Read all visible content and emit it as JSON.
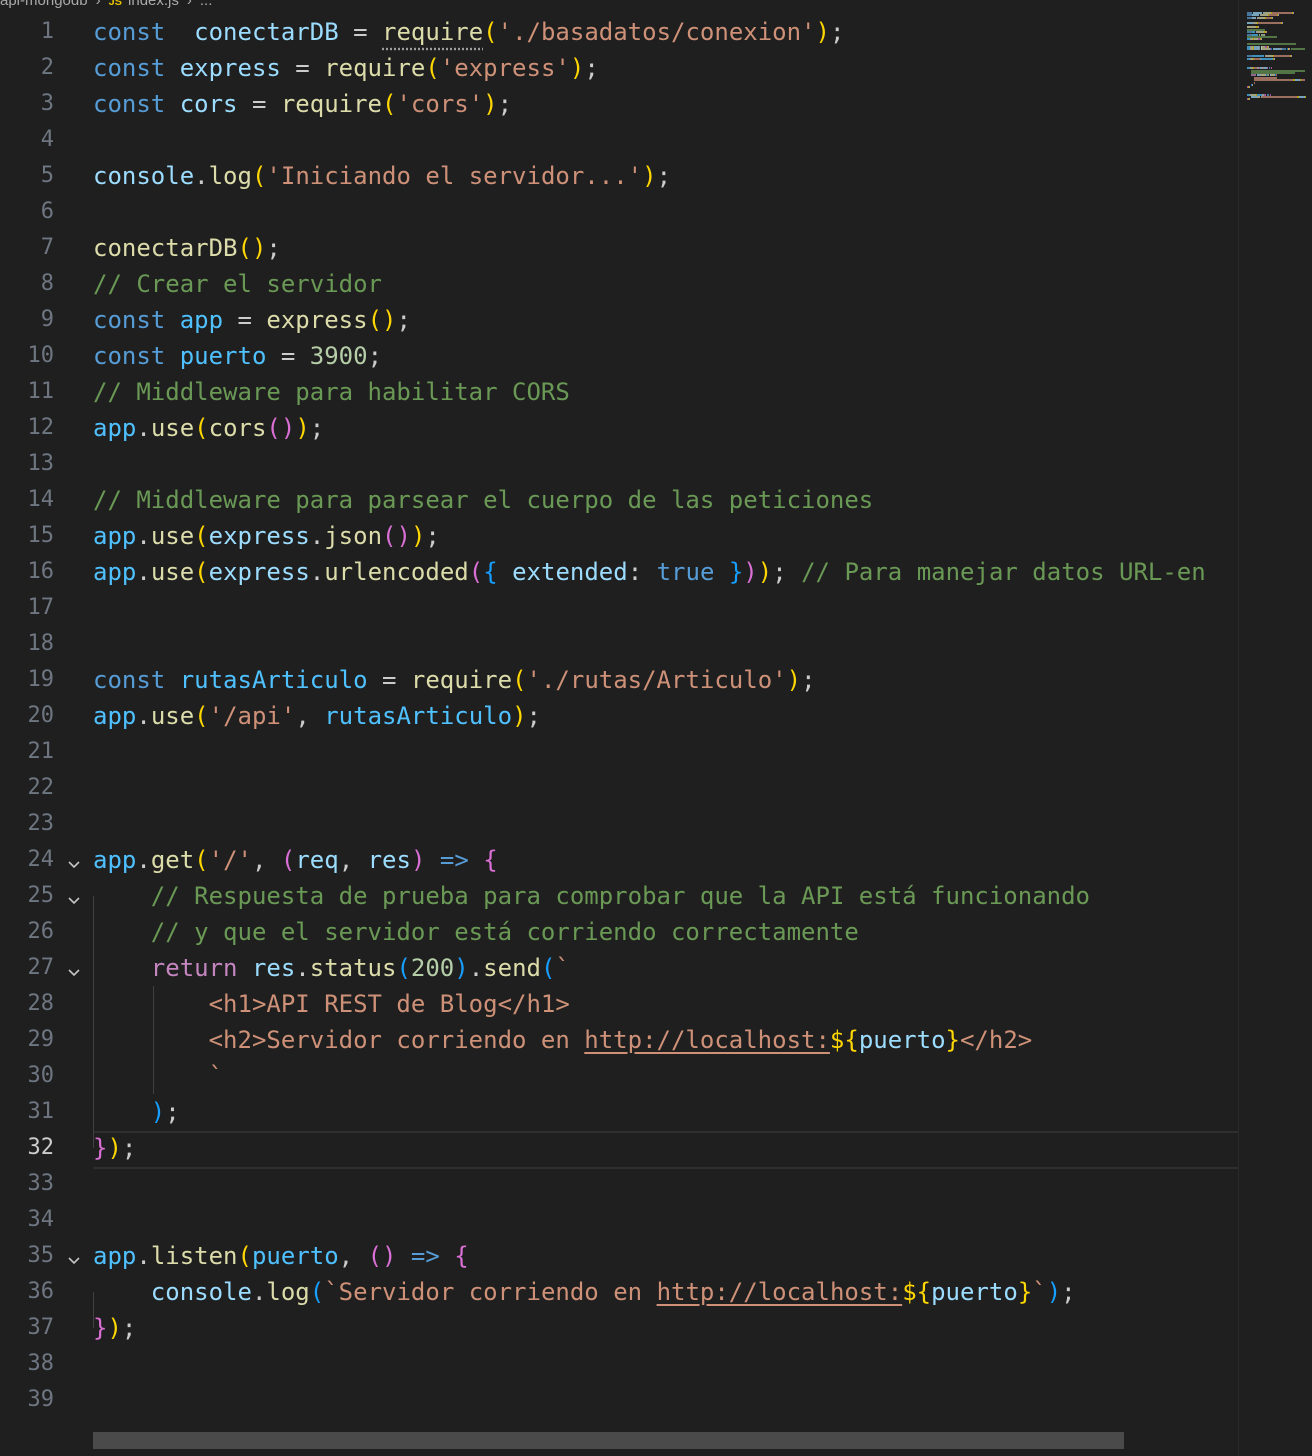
{
  "breadcrumb": {
    "folder": "api-mongodb",
    "file": "index.js",
    "more": "..."
  },
  "active_line": 32,
  "lines": [
    {
      "n": "1",
      "t": [
        [
          "kw",
          "const"
        ],
        [
          "",
          "  "
        ],
        [
          "var",
          "conectarDB"
        ],
        [
          "",
          " = "
        ],
        [
          "fn",
          "require"
        ],
        [
          "p1",
          "("
        ],
        [
          "str",
          "'./basadatos/conexion'"
        ],
        [
          "p1",
          ")"
        ],
        [
          "",
          ";"
        ]
      ]
    },
    {
      "n": "2",
      "t": [
        [
          "kw",
          "const"
        ],
        [
          "",
          ""
        ],
        [
          "var",
          " express"
        ],
        [
          "",
          " = "
        ],
        [
          "fn",
          "require"
        ],
        [
          "p1",
          "("
        ],
        [
          "str",
          "'express'"
        ],
        [
          "p1",
          ")"
        ],
        [
          "",
          ";"
        ]
      ]
    },
    {
      "n": "3",
      "t": [
        [
          "kw",
          "const"
        ],
        [
          "var",
          " cors"
        ],
        [
          "",
          " = "
        ],
        [
          "fn",
          "require"
        ],
        [
          "p1",
          "("
        ],
        [
          "str",
          "'cors'"
        ],
        [
          "p1",
          ")"
        ],
        [
          "",
          ";"
        ]
      ]
    },
    {
      "n": "4",
      "t": []
    },
    {
      "n": "5",
      "t": [
        [
          "var",
          "console"
        ],
        [
          "",
          "."
        ],
        [
          "fn",
          "log"
        ],
        [
          "p1",
          "("
        ],
        [
          "str",
          "'Iniciando el servidor...'"
        ],
        [
          "p1",
          ")"
        ],
        [
          "",
          ";"
        ]
      ]
    },
    {
      "n": "6",
      "t": []
    },
    {
      "n": "7",
      "t": [
        [
          "fn",
          "conectarDB"
        ],
        [
          "p1",
          "()"
        ],
        [
          "",
          ";"
        ]
      ]
    },
    {
      "n": "8",
      "t": [
        [
          "cmt",
          "// Crear el servidor"
        ]
      ]
    },
    {
      "n": "9",
      "t": [
        [
          "kw",
          "const"
        ],
        [
          "cst",
          " app"
        ],
        [
          "",
          " = "
        ],
        [
          "fn",
          "express"
        ],
        [
          "p1",
          "()"
        ],
        [
          "",
          ";"
        ]
      ]
    },
    {
      "n": "10",
      "t": [
        [
          "kw",
          "const"
        ],
        [
          "cst",
          " puerto"
        ],
        [
          "",
          " = "
        ],
        [
          "num",
          "3900"
        ],
        [
          "",
          ";"
        ]
      ]
    },
    {
      "n": "11",
      "t": [
        [
          "cmt",
          "// Middleware para habilitar CORS"
        ]
      ]
    },
    {
      "n": "12",
      "t": [
        [
          "cst",
          "app"
        ],
        [
          "",
          "."
        ],
        [
          "fn",
          "use"
        ],
        [
          "p1",
          "("
        ],
        [
          "fn",
          "cors"
        ],
        [
          "p2",
          "()"
        ],
        [
          "p1",
          ")"
        ],
        [
          "",
          ";"
        ]
      ]
    },
    {
      "n": "13",
      "t": []
    },
    {
      "n": "14",
      "t": [
        [
          "cmt",
          "// Middleware para parsear el cuerpo de las peticiones"
        ]
      ]
    },
    {
      "n": "15",
      "t": [
        [
          "cst",
          "app"
        ],
        [
          "",
          "."
        ],
        [
          "fn",
          "use"
        ],
        [
          "p1",
          "("
        ],
        [
          "var",
          "express"
        ],
        [
          "",
          "."
        ],
        [
          "fn",
          "json"
        ],
        [
          "p2",
          "()"
        ],
        [
          "p1",
          ")"
        ],
        [
          "",
          ";"
        ]
      ]
    },
    {
      "n": "16",
      "t": [
        [
          "cst",
          "app"
        ],
        [
          "",
          "."
        ],
        [
          "fn",
          "use"
        ],
        [
          "p1",
          "("
        ],
        [
          "var",
          "express"
        ],
        [
          "",
          "."
        ],
        [
          "fn",
          "urlencoded"
        ],
        [
          "p2",
          "("
        ],
        [
          "p3",
          "{"
        ],
        [
          "var",
          " extended"
        ],
        [
          "",
          ": "
        ],
        [
          "kw",
          "true"
        ],
        [
          "p3",
          " }"
        ],
        [
          "p2",
          ")"
        ],
        [
          "p1",
          ")"
        ],
        [
          "",
          ";"
        ],
        [
          "cmt",
          " // Para manejar datos URL-en"
        ]
      ]
    },
    {
      "n": "17",
      "t": []
    },
    {
      "n": "18",
      "t": []
    },
    {
      "n": "19",
      "t": [
        [
          "kw",
          "const"
        ],
        [
          "cst",
          " rutasArticulo"
        ],
        [
          "",
          " = "
        ],
        [
          "fn",
          "require"
        ],
        [
          "p1",
          "("
        ],
        [
          "str",
          "'./rutas/Articulo'"
        ],
        [
          "p1",
          ")"
        ],
        [
          "",
          ";"
        ]
      ]
    },
    {
      "n": "20",
      "t": [
        [
          "cst",
          "app"
        ],
        [
          "",
          "."
        ],
        [
          "fn",
          "use"
        ],
        [
          "p1",
          "("
        ],
        [
          "str",
          "'/api'"
        ],
        [
          "",
          ", "
        ],
        [
          "cst",
          "rutasArticulo"
        ],
        [
          "p1",
          ")"
        ],
        [
          "",
          ";"
        ]
      ]
    },
    {
      "n": "21",
      "t": []
    },
    {
      "n": "22",
      "t": []
    },
    {
      "n": "23",
      "t": []
    },
    {
      "n": "24",
      "fold": true,
      "t": [
        [
          "cst",
          "app"
        ],
        [
          "",
          "."
        ],
        [
          "fn",
          "get"
        ],
        [
          "p1",
          "("
        ],
        [
          "str",
          "'/'"
        ],
        [
          "",
          ", "
        ],
        [
          "p2",
          "("
        ],
        [
          "var",
          "req"
        ],
        [
          "",
          ", "
        ],
        [
          "var",
          "res"
        ],
        [
          "p2",
          ")"
        ],
        [
          "kw",
          " =>"
        ],
        [
          "p2",
          " {"
        ]
      ]
    },
    {
      "n": "25",
      "fold": true,
      "t": [
        [
          "",
          "    "
        ],
        [
          "cmt",
          "// Respuesta de prueba para comprobar que la API está funcionando"
        ]
      ]
    },
    {
      "n": "26",
      "t": [
        [
          "",
          "    "
        ],
        [
          "cmt",
          "// y que el servidor está corriendo correctamente"
        ]
      ]
    },
    {
      "n": "27",
      "fold": true,
      "t": [
        [
          "",
          "    "
        ],
        [
          "ctl",
          "return"
        ],
        [
          "var",
          " res"
        ],
        [
          "",
          "."
        ],
        [
          "fn",
          "status"
        ],
        [
          "p3",
          "("
        ],
        [
          "num",
          "200"
        ],
        [
          "p3",
          ")"
        ],
        [
          "",
          "."
        ],
        [
          "fn",
          "send"
        ],
        [
          "p3",
          "("
        ],
        [
          "str",
          "`"
        ]
      ]
    },
    {
      "n": "28",
      "t": [
        [
          "",
          "        "
        ],
        [
          "tag",
          "<h1>API REST de Blog</h1>"
        ]
      ]
    },
    {
      "n": "29",
      "t": [
        [
          "",
          "        "
        ],
        [
          "tag",
          "<h2>Servidor corriendo en "
        ],
        [
          "url",
          "http://localhost:"
        ],
        [
          "tpl",
          "${"
        ],
        [
          "var",
          "puerto"
        ],
        [
          "tpl",
          "}"
        ],
        [
          "tag",
          "</h2>"
        ]
      ]
    },
    {
      "n": "30",
      "t": [
        [
          "",
          "        "
        ],
        [
          "str",
          "`"
        ]
      ]
    },
    {
      "n": "31",
      "t": [
        [
          "",
          "    "
        ],
        [
          "p3",
          ")"
        ],
        [
          "",
          ";"
        ]
      ]
    },
    {
      "n": "32",
      "t": [
        [
          "p2",
          "}"
        ],
        [
          "p1",
          ")"
        ],
        [
          "",
          ";"
        ]
      ]
    },
    {
      "n": "33",
      "t": []
    },
    {
      "n": "34",
      "t": []
    },
    {
      "n": "35",
      "fold": true,
      "t": [
        [
          "cst",
          "app"
        ],
        [
          "",
          "."
        ],
        [
          "fn",
          "listen"
        ],
        [
          "p1",
          "("
        ],
        [
          "cst",
          "puerto"
        ],
        [
          "",
          ", "
        ],
        [
          "p2",
          "()"
        ],
        [
          "kw",
          " =>"
        ],
        [
          "p2",
          " {"
        ]
      ]
    },
    {
      "n": "36",
      "t": [
        [
          "",
          "    "
        ],
        [
          "var",
          "console"
        ],
        [
          "",
          "."
        ],
        [
          "fn",
          "log"
        ],
        [
          "p3",
          "("
        ],
        [
          "str",
          "`Servidor corriendo en "
        ],
        [
          "url",
          "http://localhost:"
        ],
        [
          "tpl",
          "${"
        ],
        [
          "var",
          "puerto"
        ],
        [
          "tpl",
          "}"
        ],
        [
          "str",
          "`"
        ],
        [
          "p3",
          ")"
        ],
        [
          "",
          ";"
        ]
      ]
    },
    {
      "n": "37",
      "t": [
        [
          "p2",
          "}"
        ],
        [
          "p1",
          ")"
        ],
        [
          "",
          ";"
        ]
      ]
    },
    {
      "n": "38",
      "t": []
    },
    {
      "n": "39",
      "t": []
    }
  ],
  "colors": {
    "background": "#1f1f1f",
    "keyword": "#569cd6",
    "string": "#ce9178",
    "comment": "#6a9955",
    "function": "#dcdcaa",
    "variable": "#9cdcfe"
  }
}
